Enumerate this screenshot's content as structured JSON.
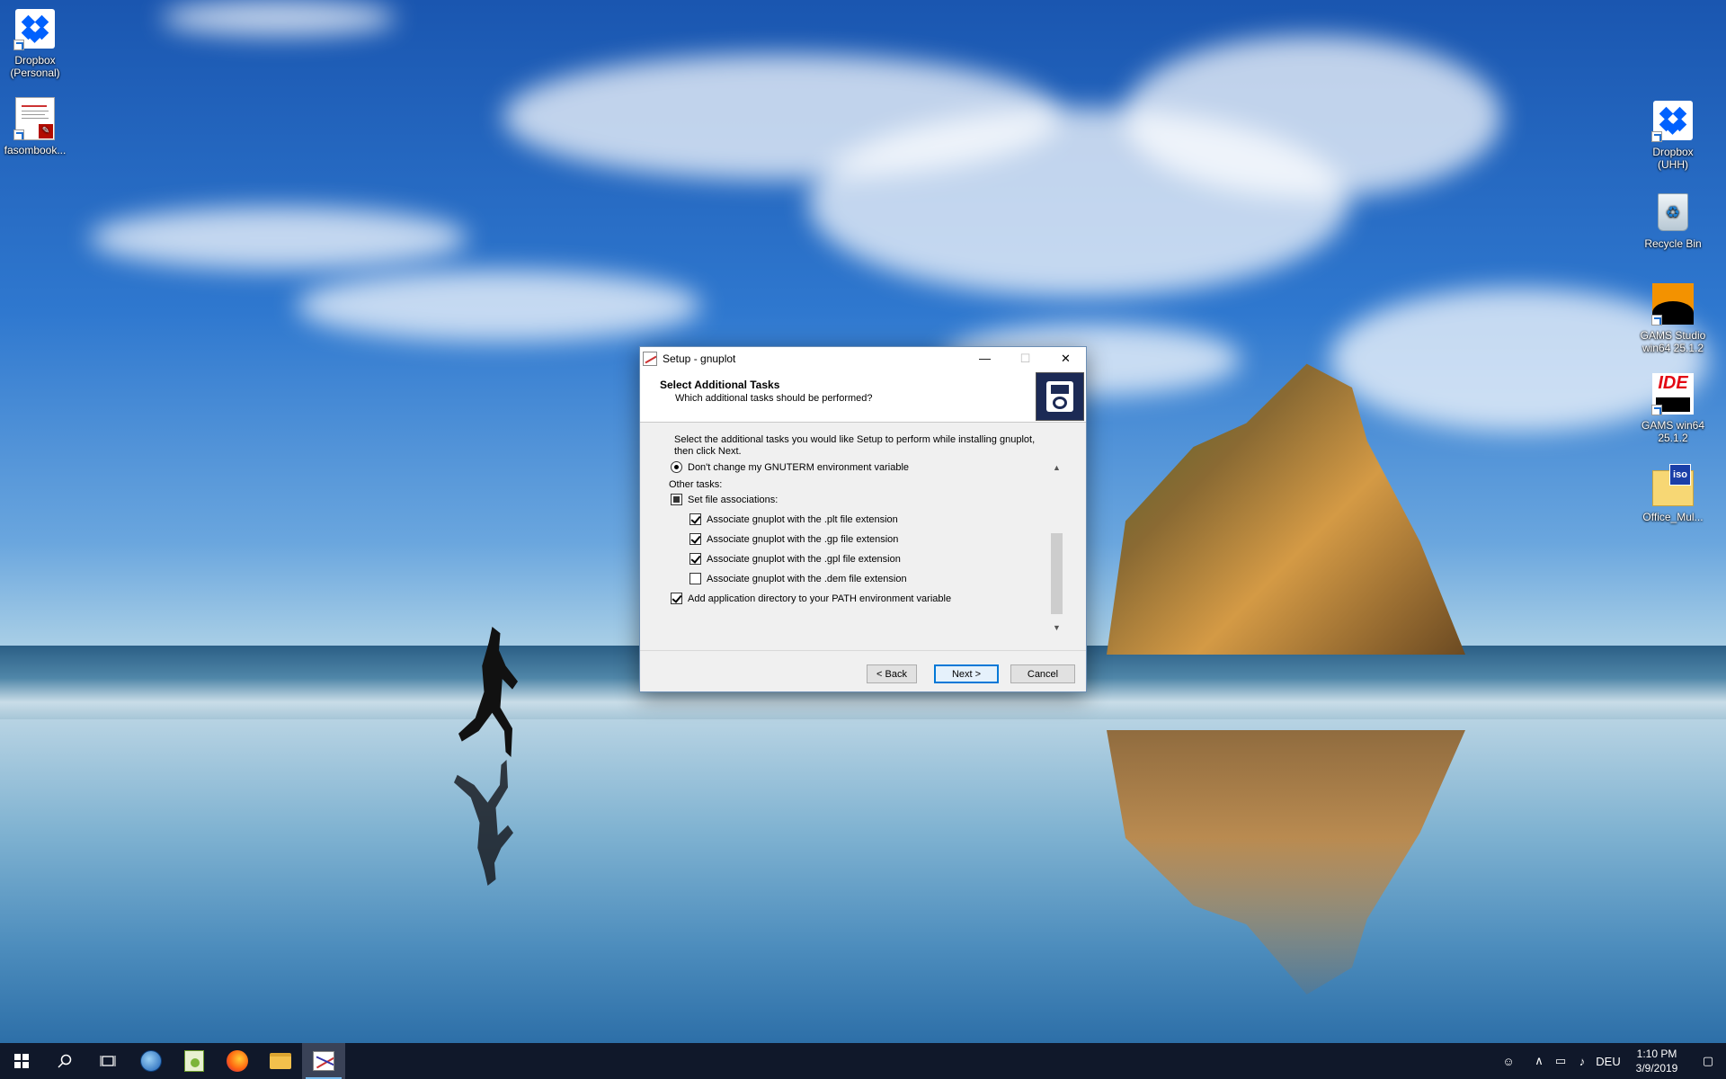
{
  "desktop": {
    "icons_left": [
      {
        "label": "Dropbox\n(Personal)",
        "line1": "Dropbox",
        "line2": "(Personal)"
      },
      {
        "label": "fasombook...",
        "line1": "fasombook...",
        "line2": ""
      }
    ],
    "icons_right": [
      {
        "line1": "Dropbox",
        "line2": "(UHH)"
      },
      {
        "line1": "Recycle Bin",
        "line2": ""
      },
      {
        "line1": "GAMS Studio",
        "line2": "win64 25.1.2"
      },
      {
        "line1": "GAMS win64",
        "line2": "25.1.2"
      },
      {
        "line1": "Office_Mul...",
        "line2": ""
      }
    ],
    "ide_text": "IDE",
    "iso_text": "iso"
  },
  "dialog": {
    "title": "Setup - gnuplot",
    "minimize": "—",
    "maximize": "☐",
    "close": "✕",
    "header_title": "Select Additional Tasks",
    "header_subtitle": "Which additional tasks should be performed?",
    "intro_line1": "Select the additional tasks you would like Setup to perform while installing gnuplot,",
    "intro_line2": "then click Next.",
    "tasks": {
      "radio_gnuterm": "Don't change my GNUTERM environment variable",
      "other_tasks": "Other tasks:",
      "set_file_assoc": "Set file associations:",
      "assoc_plt": "Associate gnuplot with the .plt file extension",
      "assoc_gp": "Associate gnuplot with the .gp file extension",
      "assoc_gpl": "Associate gnuplot with the .gpl file extension",
      "assoc_dem": "Associate gnuplot with the .dem file extension",
      "add_path": "Add application directory to your PATH environment variable"
    },
    "states": {
      "radio_gnuterm": true,
      "set_file_assoc": "partial",
      "assoc_plt": true,
      "assoc_gp": true,
      "assoc_gpl": true,
      "assoc_dem": false,
      "add_path": true
    },
    "buttons": {
      "back": "< Back",
      "next": "Next >",
      "cancel": "Cancel"
    }
  },
  "taskbar": {
    "tray_language": "DEU",
    "time": "1:10 PM",
    "date": "3/9/2019"
  }
}
